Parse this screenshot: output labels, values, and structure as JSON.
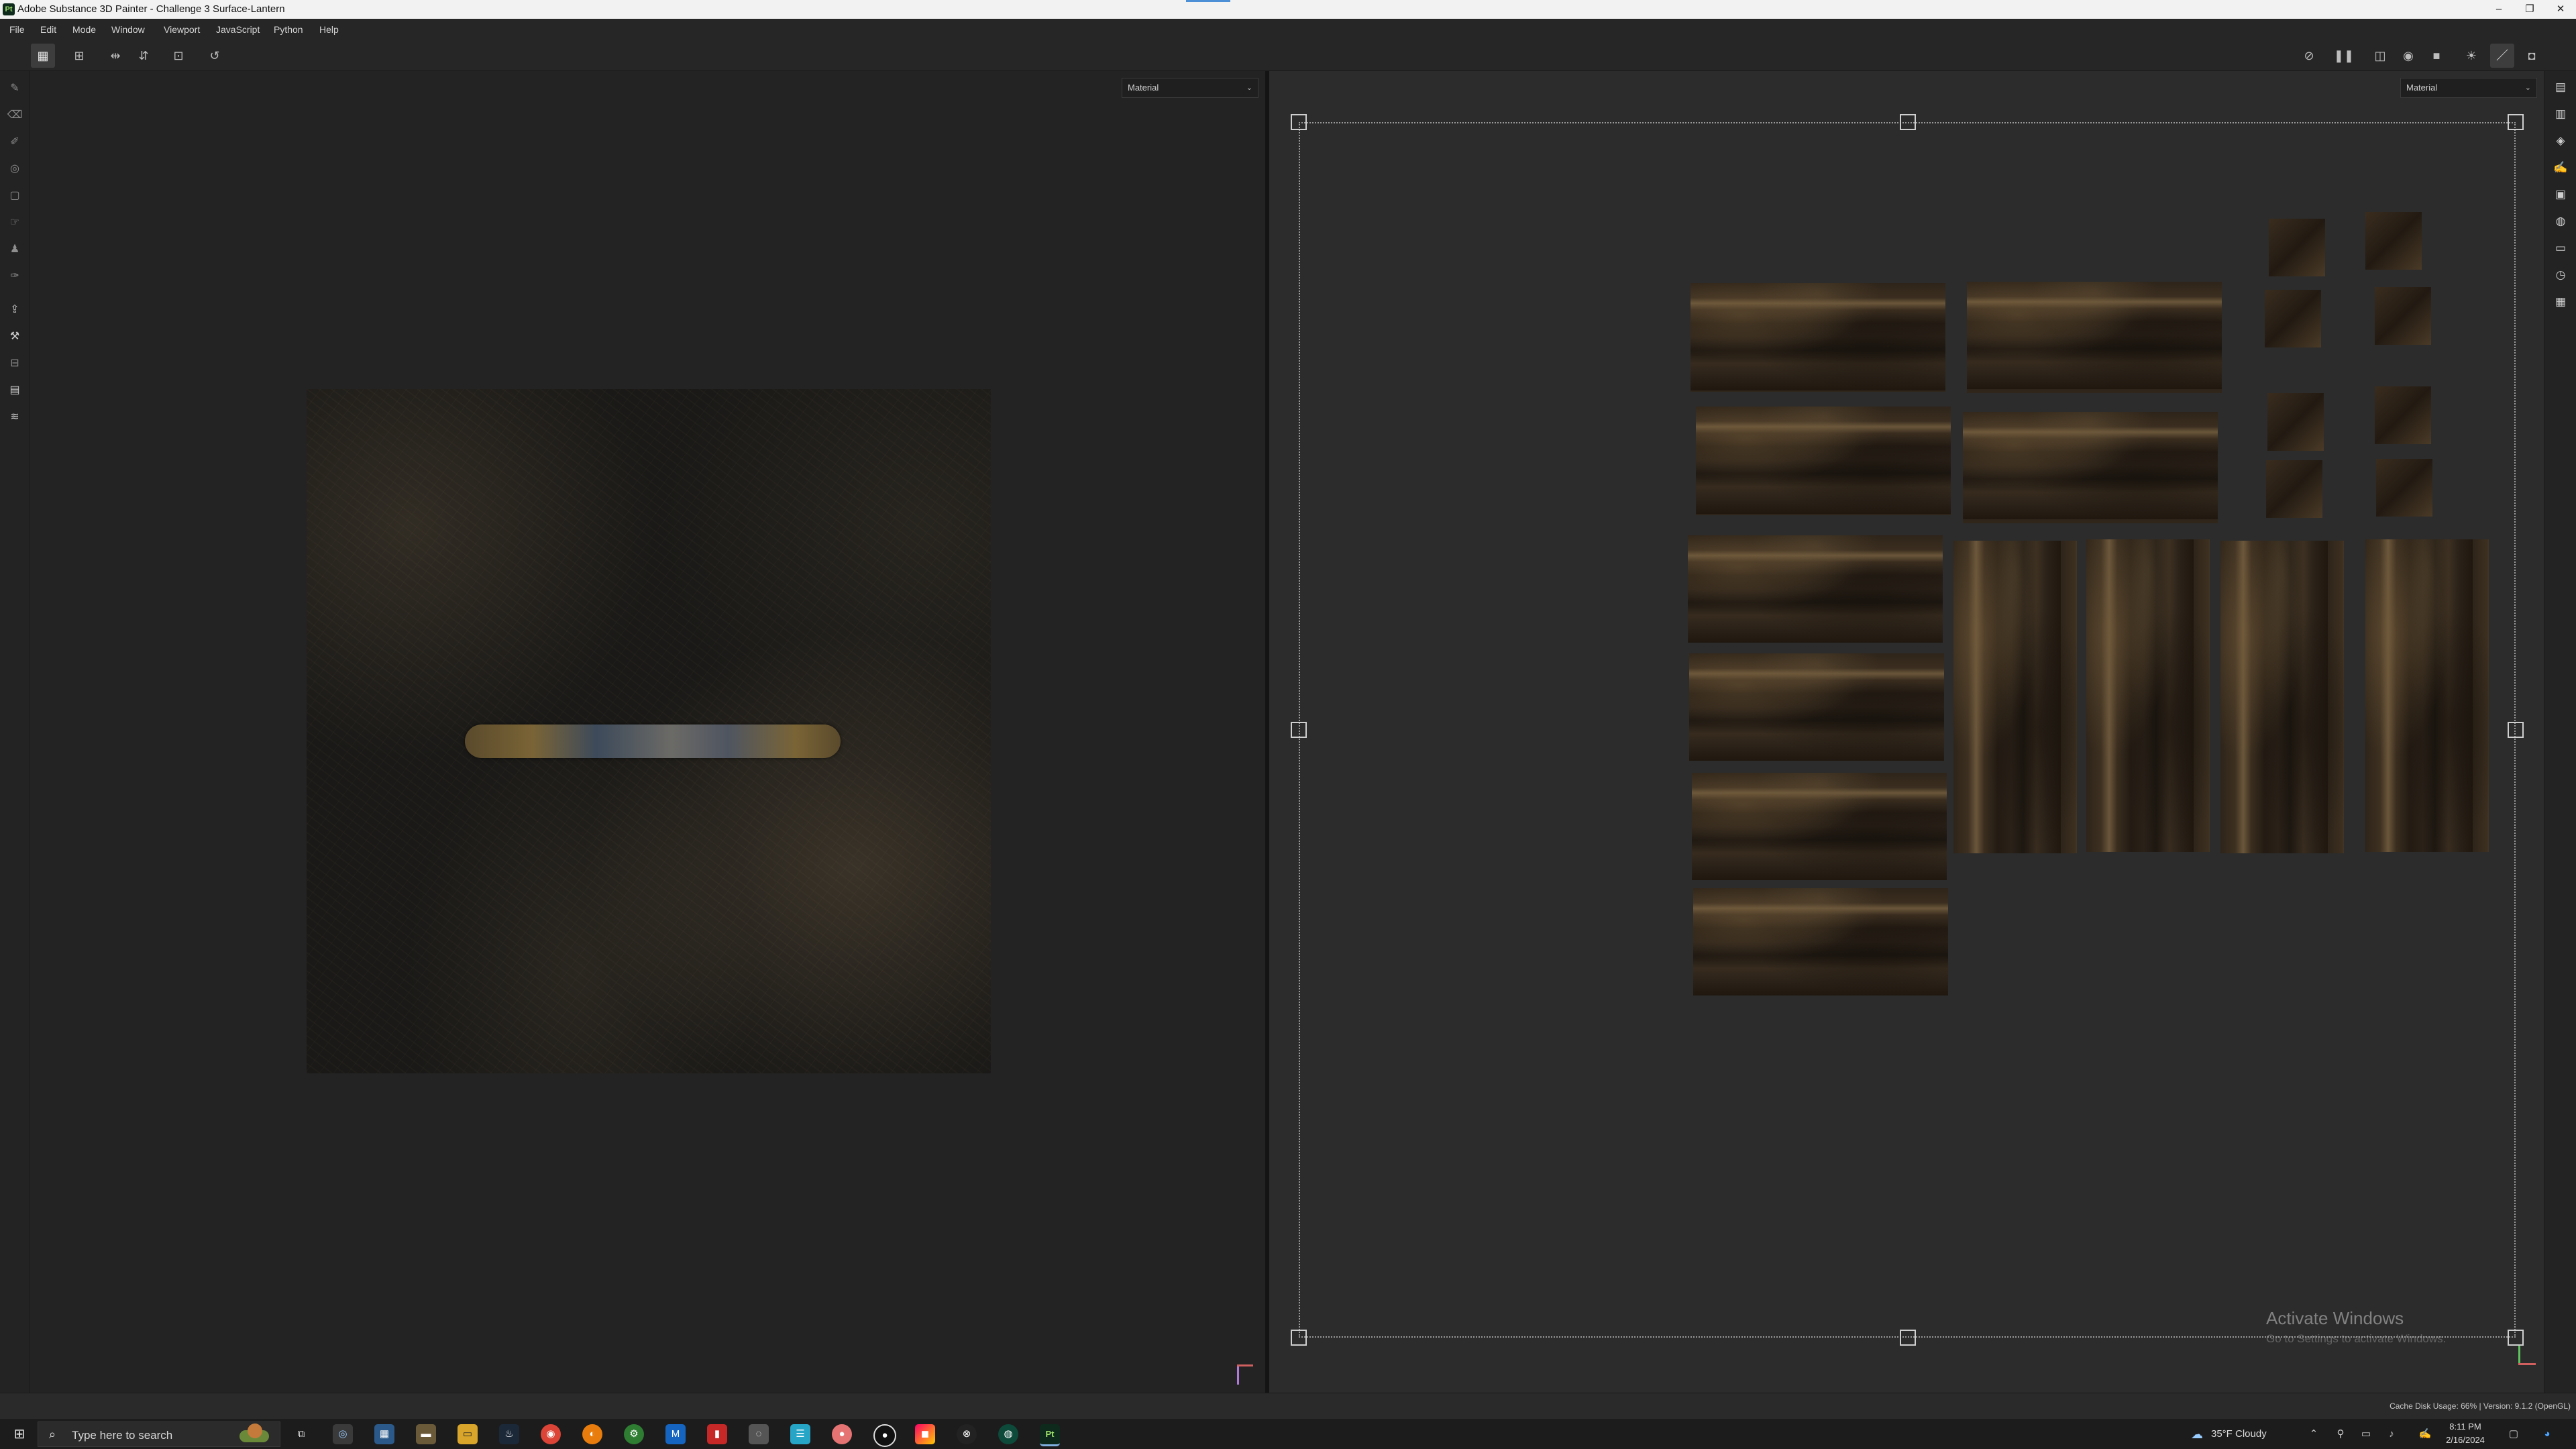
{
  "window": {
    "title": "Adobe Substance 3D Painter - Challenge 3 Surface-Lantern",
    "logo_text": "Pt",
    "controls": {
      "minimize": "–",
      "maximize": "❐",
      "close": "✕"
    }
  },
  "menu": [
    "File",
    "Edit",
    "Mode",
    "Window",
    "Viewport",
    "JavaScript",
    "Python",
    "Help"
  ],
  "toolbar": {
    "left_icons": [
      "grid-view-icon",
      "tiled-grid-icon",
      "symmetry-x-icon",
      "symmetry-y-icon",
      "frame-icon",
      "history-icon"
    ],
    "right_icons": [
      "hide-overlay-icon",
      "pause-icon",
      "split-view-icon",
      "sphere-icon",
      "camera-icon",
      "light-icon",
      "brush-icon",
      "screenshot-icon"
    ]
  },
  "viewport3d": {
    "material_dropdown": "Material"
  },
  "viewport2d": {
    "material_dropdown": "Material"
  },
  "watermark": {
    "line1": "Activate Windows",
    "line2": "Go to Settings to activate Windows."
  },
  "status": {
    "text": "Cache Disk Usage:   66% | Version: 9.1.2 (OpenGL)"
  },
  "taskbar": {
    "search_placeholder": "Type here to search",
    "weather": "35°F  Cloudy",
    "time": "8:11 PM",
    "date": "2/16/2024"
  }
}
